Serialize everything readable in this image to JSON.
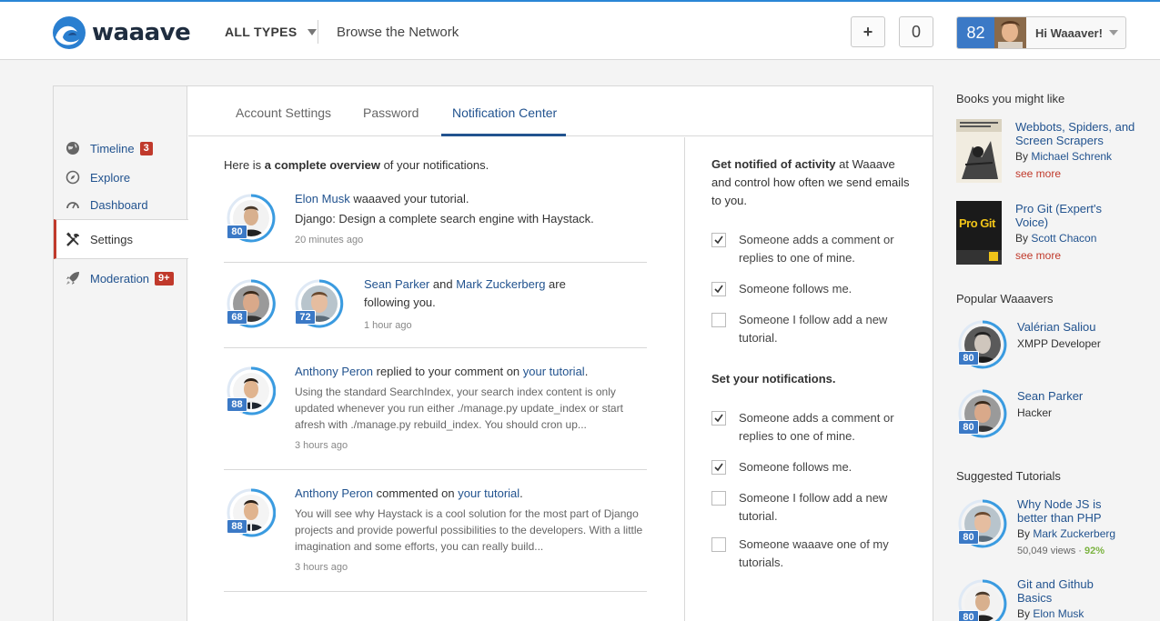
{
  "header": {
    "brand": "waaave",
    "types_label": "ALL TYPES",
    "browse_label": "Browse the Network",
    "add_label": "+",
    "count_label": "0",
    "user_score": "82",
    "user_greeting": "Hi Waaaver!",
    "accent_color": "#2a86d6"
  },
  "sidebar": {
    "items": [
      {
        "label": "Timeline",
        "badge": "3",
        "icon": "globe-icon"
      },
      {
        "label": "Explore",
        "icon": "compass-icon"
      },
      {
        "label": "Dashboard",
        "icon": "gauge-icon"
      },
      {
        "label": "Settings",
        "icon": "tools-icon"
      },
      {
        "label": "Moderation",
        "badge": "9+",
        "icon": "rocket-icon"
      }
    ]
  },
  "tabs": [
    {
      "label": "Account Settings"
    },
    {
      "label": "Password"
    },
    {
      "label": "Notification Center"
    }
  ],
  "feed": {
    "intro_pre": "Here is ",
    "intro_bold": "a complete overview",
    "intro_post": " of your notifications.",
    "n1": {
      "actor": "Elon Musk",
      "action": " waaaved your tutorial.",
      "link": "Django: Design a complete search engine with Haystack.",
      "time": "20 minutes ago",
      "level": "80"
    },
    "n2": {
      "actor1": "Sean Parker",
      "and": " and ",
      "actor2": "Mark Zuckerberg",
      "action": " are following you.",
      "time": "1 hour ago",
      "level1": "68",
      "level2": "72"
    },
    "n3": {
      "actor": "Anthony Peron",
      "action": " replied to your comment on ",
      "link": "your tutorial",
      "end": ".",
      "excerpt": "Using the standard SearchIndex, your search index content is only updated whenever you run either ./manage.py update_index or start afresh with ./manage.py rebuild_index. You should cron up...",
      "time": "3 hours ago",
      "level": "88"
    },
    "n4": {
      "actor": "Anthony Peron",
      "action": " commented on ",
      "link": "your tutorial",
      "end": ".",
      "excerpt": "You will see why Haystack is a cool solution for the most part of Django projects and provide powerful possibilities to the developers. With a little imagination and some efforts, you can really build...",
      "time": "3 hours ago",
      "level": "88"
    }
  },
  "settings": {
    "head1_bold": "Get notified of activity",
    "head1_rest": " at Waaave and control how often we send emails to you.",
    "group1": [
      {
        "label": "Someone adds a comment or replies to one of mine.",
        "checked": true
      },
      {
        "label": "Someone follows me.",
        "checked": true
      },
      {
        "label": "Someone I follow add a new tutorial.",
        "checked": false
      }
    ],
    "head2": "Set your notifications.",
    "group2": [
      {
        "label": "Someone adds a comment or replies to one of mine.",
        "checked": true
      },
      {
        "label": "Someone follows me.",
        "checked": true
      },
      {
        "label": "Someone I follow add a new tutorial.",
        "checked": false
      },
      {
        "label": "Someone waaave one of my tutorials.",
        "checked": false
      }
    ]
  },
  "aside": {
    "books_heading": "Books you might like",
    "books": [
      {
        "title": "Webbots, Spiders, and Screen Scrapers",
        "by": "By ",
        "author": "Michael Schrenk",
        "more": "see more"
      },
      {
        "title": "Pro Git (Expert's Voice)",
        "by": "By ",
        "author": "Scott Chacon",
        "more": "see more",
        "cover_text": "Pro Git"
      }
    ],
    "popular_heading": "Popular Waaavers",
    "popular": [
      {
        "name": "Valérian Saliou",
        "desc": "XMPP Developer",
        "level": "80"
      },
      {
        "name": "Sean Parker",
        "desc": "Hacker",
        "level": "80"
      }
    ],
    "tutorials_heading": "Suggested Tutorials",
    "tutorials": [
      {
        "title": "Why Node JS is better than PHP",
        "by": "By ",
        "author": "Mark Zuckerberg",
        "views": "50,049 views",
        "sep": " · ",
        "pct": "92%",
        "level": "80"
      },
      {
        "title": "Git and Github Basics",
        "by": "By ",
        "author": "Elon Musk",
        "level": "80"
      }
    ]
  }
}
